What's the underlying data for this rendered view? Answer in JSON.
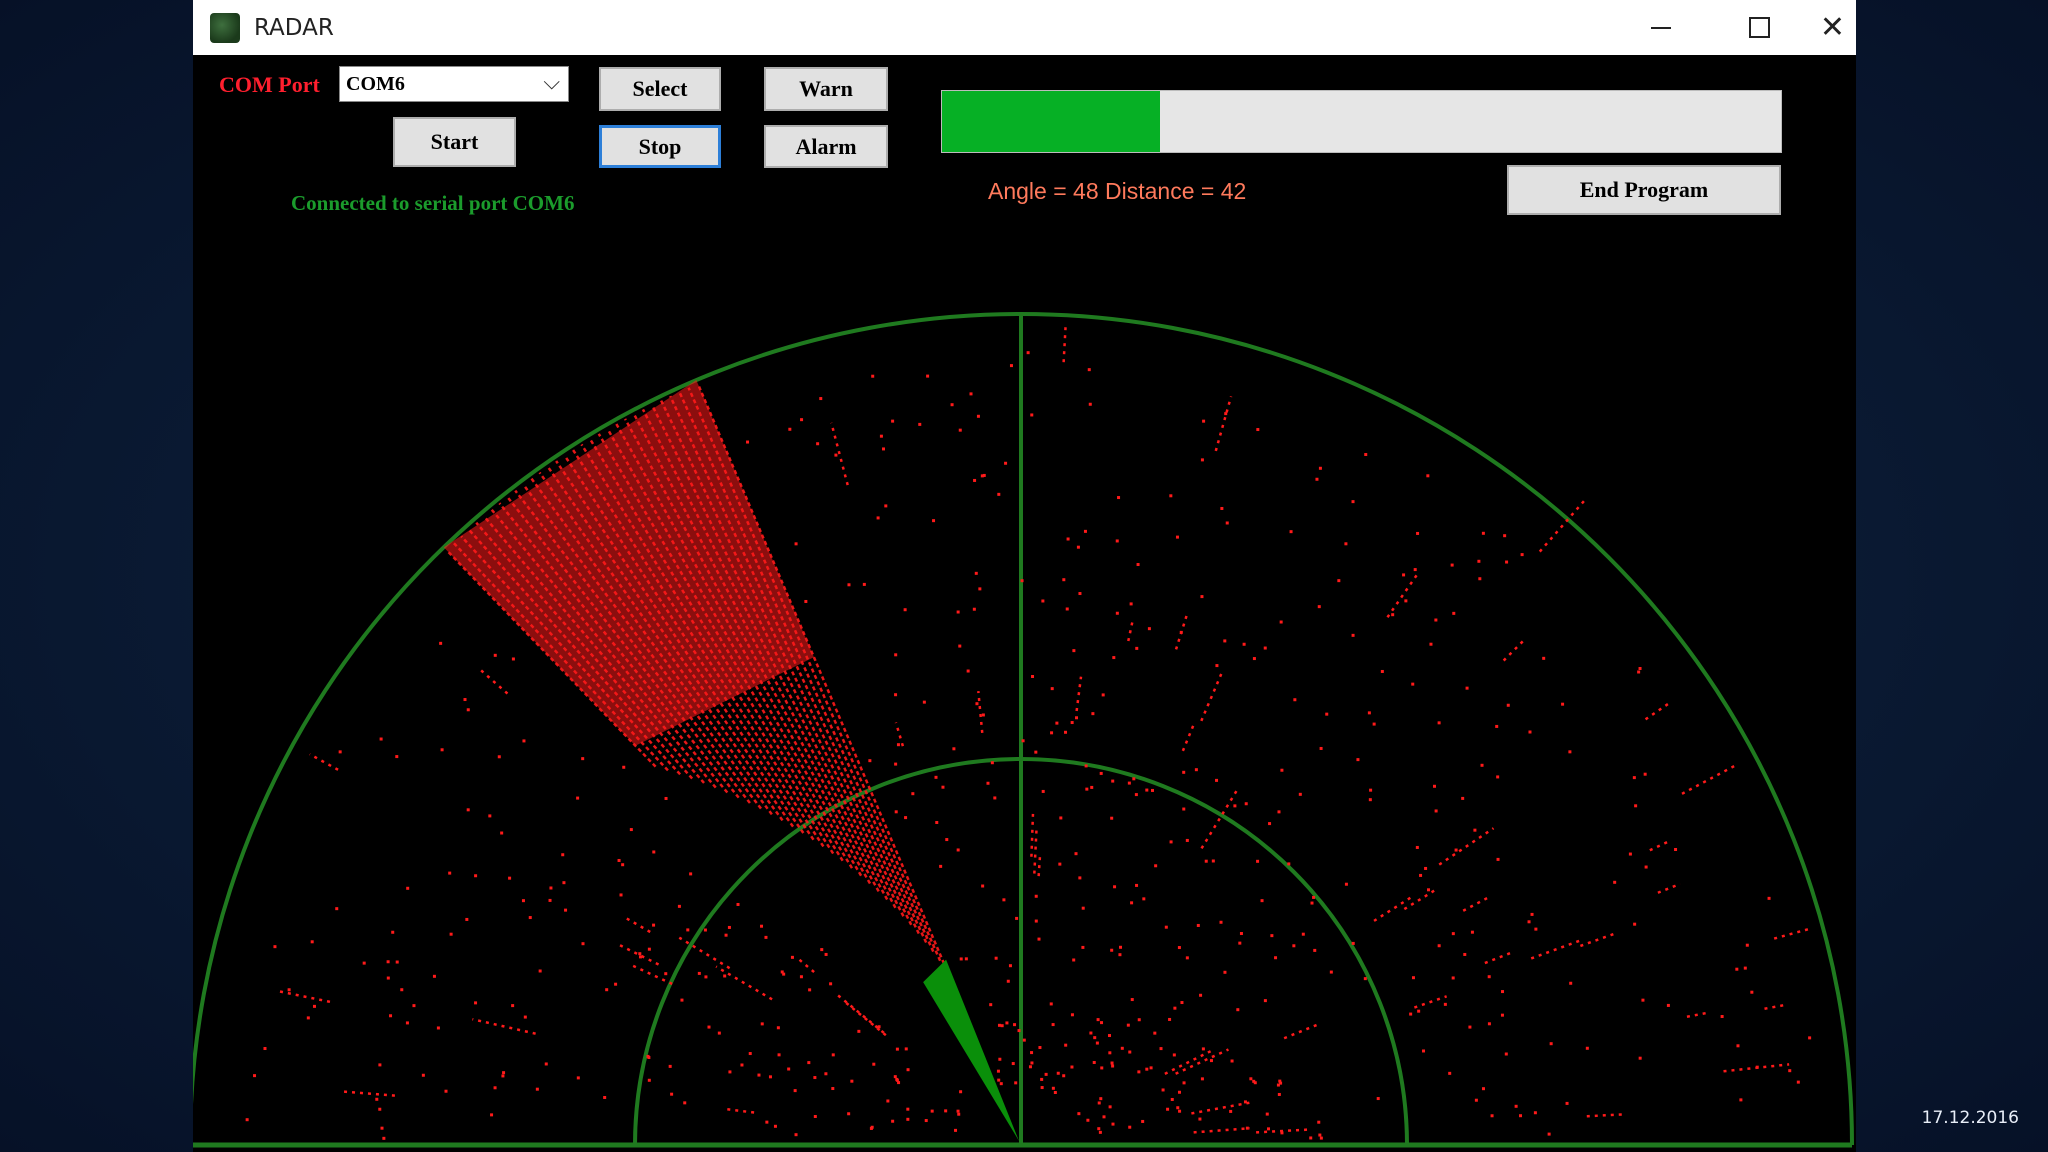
{
  "window": {
    "title": "RADAR"
  },
  "controls": {
    "com_port_label": "COM Port",
    "com_port_value": "COM6",
    "select_label": "Select",
    "start_label": "Start",
    "stop_label": "Stop",
    "warn_label": "Warn",
    "alarm_label": "Alarm",
    "end_program_label": "End Program"
  },
  "status": {
    "text": "Connected to serial port COM6"
  },
  "progress": {
    "fraction": 0.26
  },
  "readout": {
    "text": "Angle = 48 Distance = 42"
  },
  "radar": {
    "angle": 48,
    "distance": 42,
    "sweep_color": "#0a8f0a",
    "echo_color": "#ff1a1a",
    "grid_color": "#1f7a1f"
  },
  "colors": {
    "com_label": "#ff1f2e",
    "status_text": "#1b9c2c",
    "readout_text": "#ff7a5c",
    "progress_fill": "#06b025",
    "focus_border": "#2d7fd8"
  },
  "icons": {
    "app": "radar-app-icon",
    "minimize": "minimize-icon",
    "maximize": "maximize-icon",
    "close": "close-icon",
    "dropdown": "chevron-down-icon"
  },
  "desktop": {
    "date": "17.12.2016"
  }
}
